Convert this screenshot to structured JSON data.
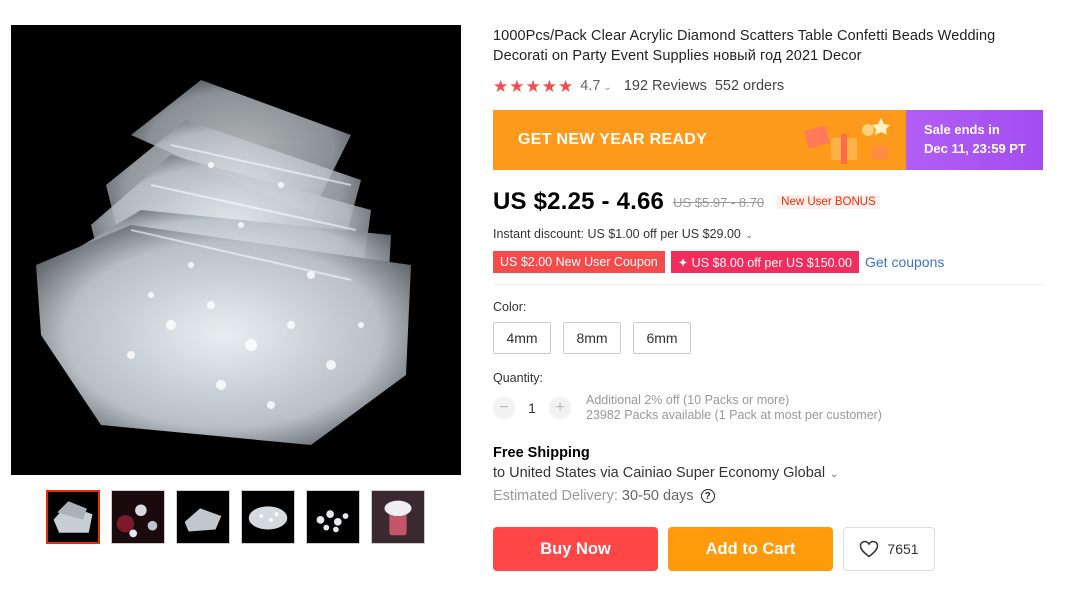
{
  "product": {
    "title": "1000Pcs/Pack Clear Acrylic Diamond Scatters Table Confetti Beads Wedding Decorati on Party Event Supplies новый год 2021 Decor"
  },
  "rating": {
    "value": "4.7",
    "stars": 5,
    "reviews": "192 Reviews",
    "orders": "552 orders",
    "star_color": "#f44b4b"
  },
  "banner": {
    "title": "GET NEW YEAR READY",
    "sale_line1": "Sale ends in",
    "sale_line2": "Dec 11, 23:59 PT",
    "left_color": "#fd9a1b",
    "right_color": "#a34df0"
  },
  "price": {
    "current": "US $2.25 - 4.66",
    "original": "US $5.97 - 8.70",
    "badge": "New User BONUS"
  },
  "discount": {
    "instant": "Instant discount: US $1.00 off per US $29.00"
  },
  "coupons": {
    "items": [
      "US $2.00 New User Coupon",
      "✦ US $8.00 off per US $150.00"
    ],
    "get_link": "Get coupons"
  },
  "color": {
    "label": "Color:",
    "options": [
      "4mm",
      "8mm",
      "6mm"
    ]
  },
  "quantity": {
    "label": "Quantity:",
    "value": "1",
    "minus": "−",
    "plus": "+",
    "note1": "Additional 2% off (10 Packs or more)",
    "note2": "23982 Packs available (1 Pack at most per customer)"
  },
  "shipping": {
    "title": "Free Shipping",
    "line": "to United States via Cainiao Super Economy Global",
    "delivery_label": "Estimated Delivery:",
    "delivery_days": "30-50 days",
    "help_icon": "?"
  },
  "actions": {
    "buy": "Buy Now",
    "cart": "Add to Cart",
    "wishlist_count": "7651"
  },
  "colors": {
    "buy": "#ff4747",
    "cart": "#ff9a0a",
    "coupon_link": "#3a73c7"
  }
}
